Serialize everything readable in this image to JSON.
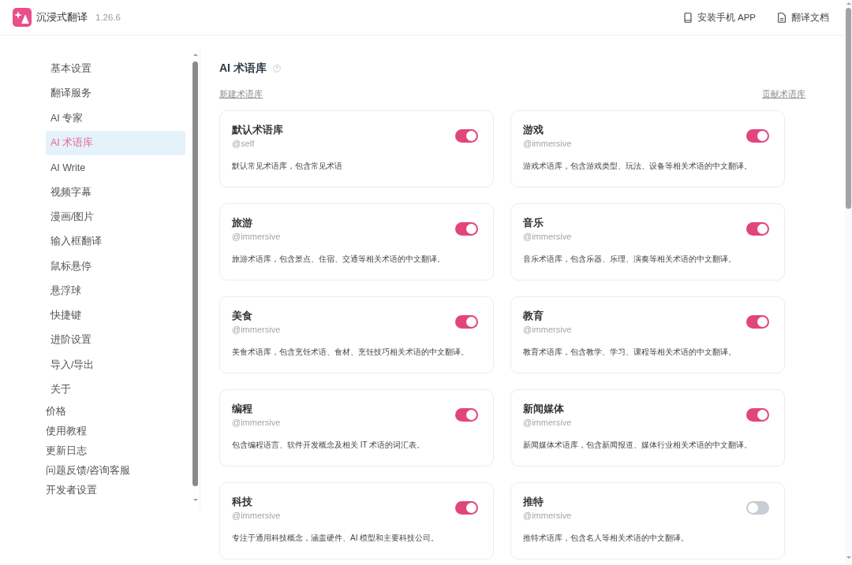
{
  "app": {
    "name": "沉浸式翻译",
    "version": "1.26.6"
  },
  "header_links": [
    {
      "kind": "phone",
      "label": "安装手机 APP"
    },
    {
      "kind": "document",
      "label": "翻译文档"
    }
  ],
  "sidebar": {
    "settings_items": [
      {
        "label": "基本设置",
        "selected": false
      },
      {
        "label": "翻译服务",
        "selected": false
      },
      {
        "label": "AI 专家",
        "selected": false
      },
      {
        "label": "AI 术语库",
        "selected": true
      },
      {
        "label": "AI Write",
        "selected": false
      },
      {
        "label": "视频字幕",
        "selected": false
      },
      {
        "label": "漫画/图片",
        "selected": false
      },
      {
        "label": "输入框翻译",
        "selected": false
      },
      {
        "label": "鼠标悬停",
        "selected": false
      },
      {
        "label": "悬浮球",
        "selected": false
      },
      {
        "label": "快捷键",
        "selected": false
      },
      {
        "label": "进阶设置",
        "selected": false
      },
      {
        "label": "导入/导出",
        "selected": false
      },
      {
        "label": "关于",
        "selected": false
      }
    ],
    "items": [
      {
        "label": "价格",
        "selected": false
      },
      {
        "label": "使用教程",
        "selected": false
      },
      {
        "label": "更新日志",
        "selected": false
      },
      {
        "label": "问题反馈/咨询客服",
        "selected": false
      },
      {
        "label": "开发者设置",
        "selected": false
      }
    ]
  },
  "page": {
    "title": "AI 术语库",
    "new_link": "新建术语库",
    "contribute_link": "贡献术语库"
  },
  "glossaries": [
    {
      "name": "默认术语库",
      "author": "@self",
      "description": "默认常见术语库，包含常见术语",
      "on": true
    },
    {
      "name": "游戏",
      "author": "@immersive",
      "description": "游戏术语库，包含游戏类型、玩法、设备等相关术语的中文翻译。",
      "on": true
    },
    {
      "name": "旅游",
      "author": "@immersive",
      "description": "旅游术语库，包含景点、住宿、交通等相关术语的中文翻译。",
      "on": true
    },
    {
      "name": "音乐",
      "author": "@immersive",
      "description": "音乐术语库，包含乐器、乐理、演奏等相关术语的中文翻译。",
      "on": true
    },
    {
      "name": "美食",
      "author": "@immersive",
      "description": "美食术语库，包含烹饪术语、食材、烹饪技巧相关术语的中文翻译。",
      "on": true
    },
    {
      "name": "教育",
      "author": "@immersive",
      "description": "教育术语库，包含教学、学习、课程等相关术语的中文翻译。",
      "on": true
    },
    {
      "name": "编程",
      "author": "@immersive",
      "description": "包含编程语言、软件开发概念及相关 IT 术语的词汇表。",
      "on": true
    },
    {
      "name": "新闻媒体",
      "author": "@immersive",
      "description": "新闻媒体术语库，包含新闻报道、媒体行业相关术语的中文翻译。",
      "on": true
    },
    {
      "name": "科技",
      "author": "@immersive",
      "description": "专注于通用科技概念，涵盖硬件、AI 模型和主要科技公司。",
      "on": true
    },
    {
      "name": "推特",
      "author": "@immersive",
      "description": "推特术语库，包含名人等相关术语的中文翻译。",
      "on": false
    }
  ]
}
